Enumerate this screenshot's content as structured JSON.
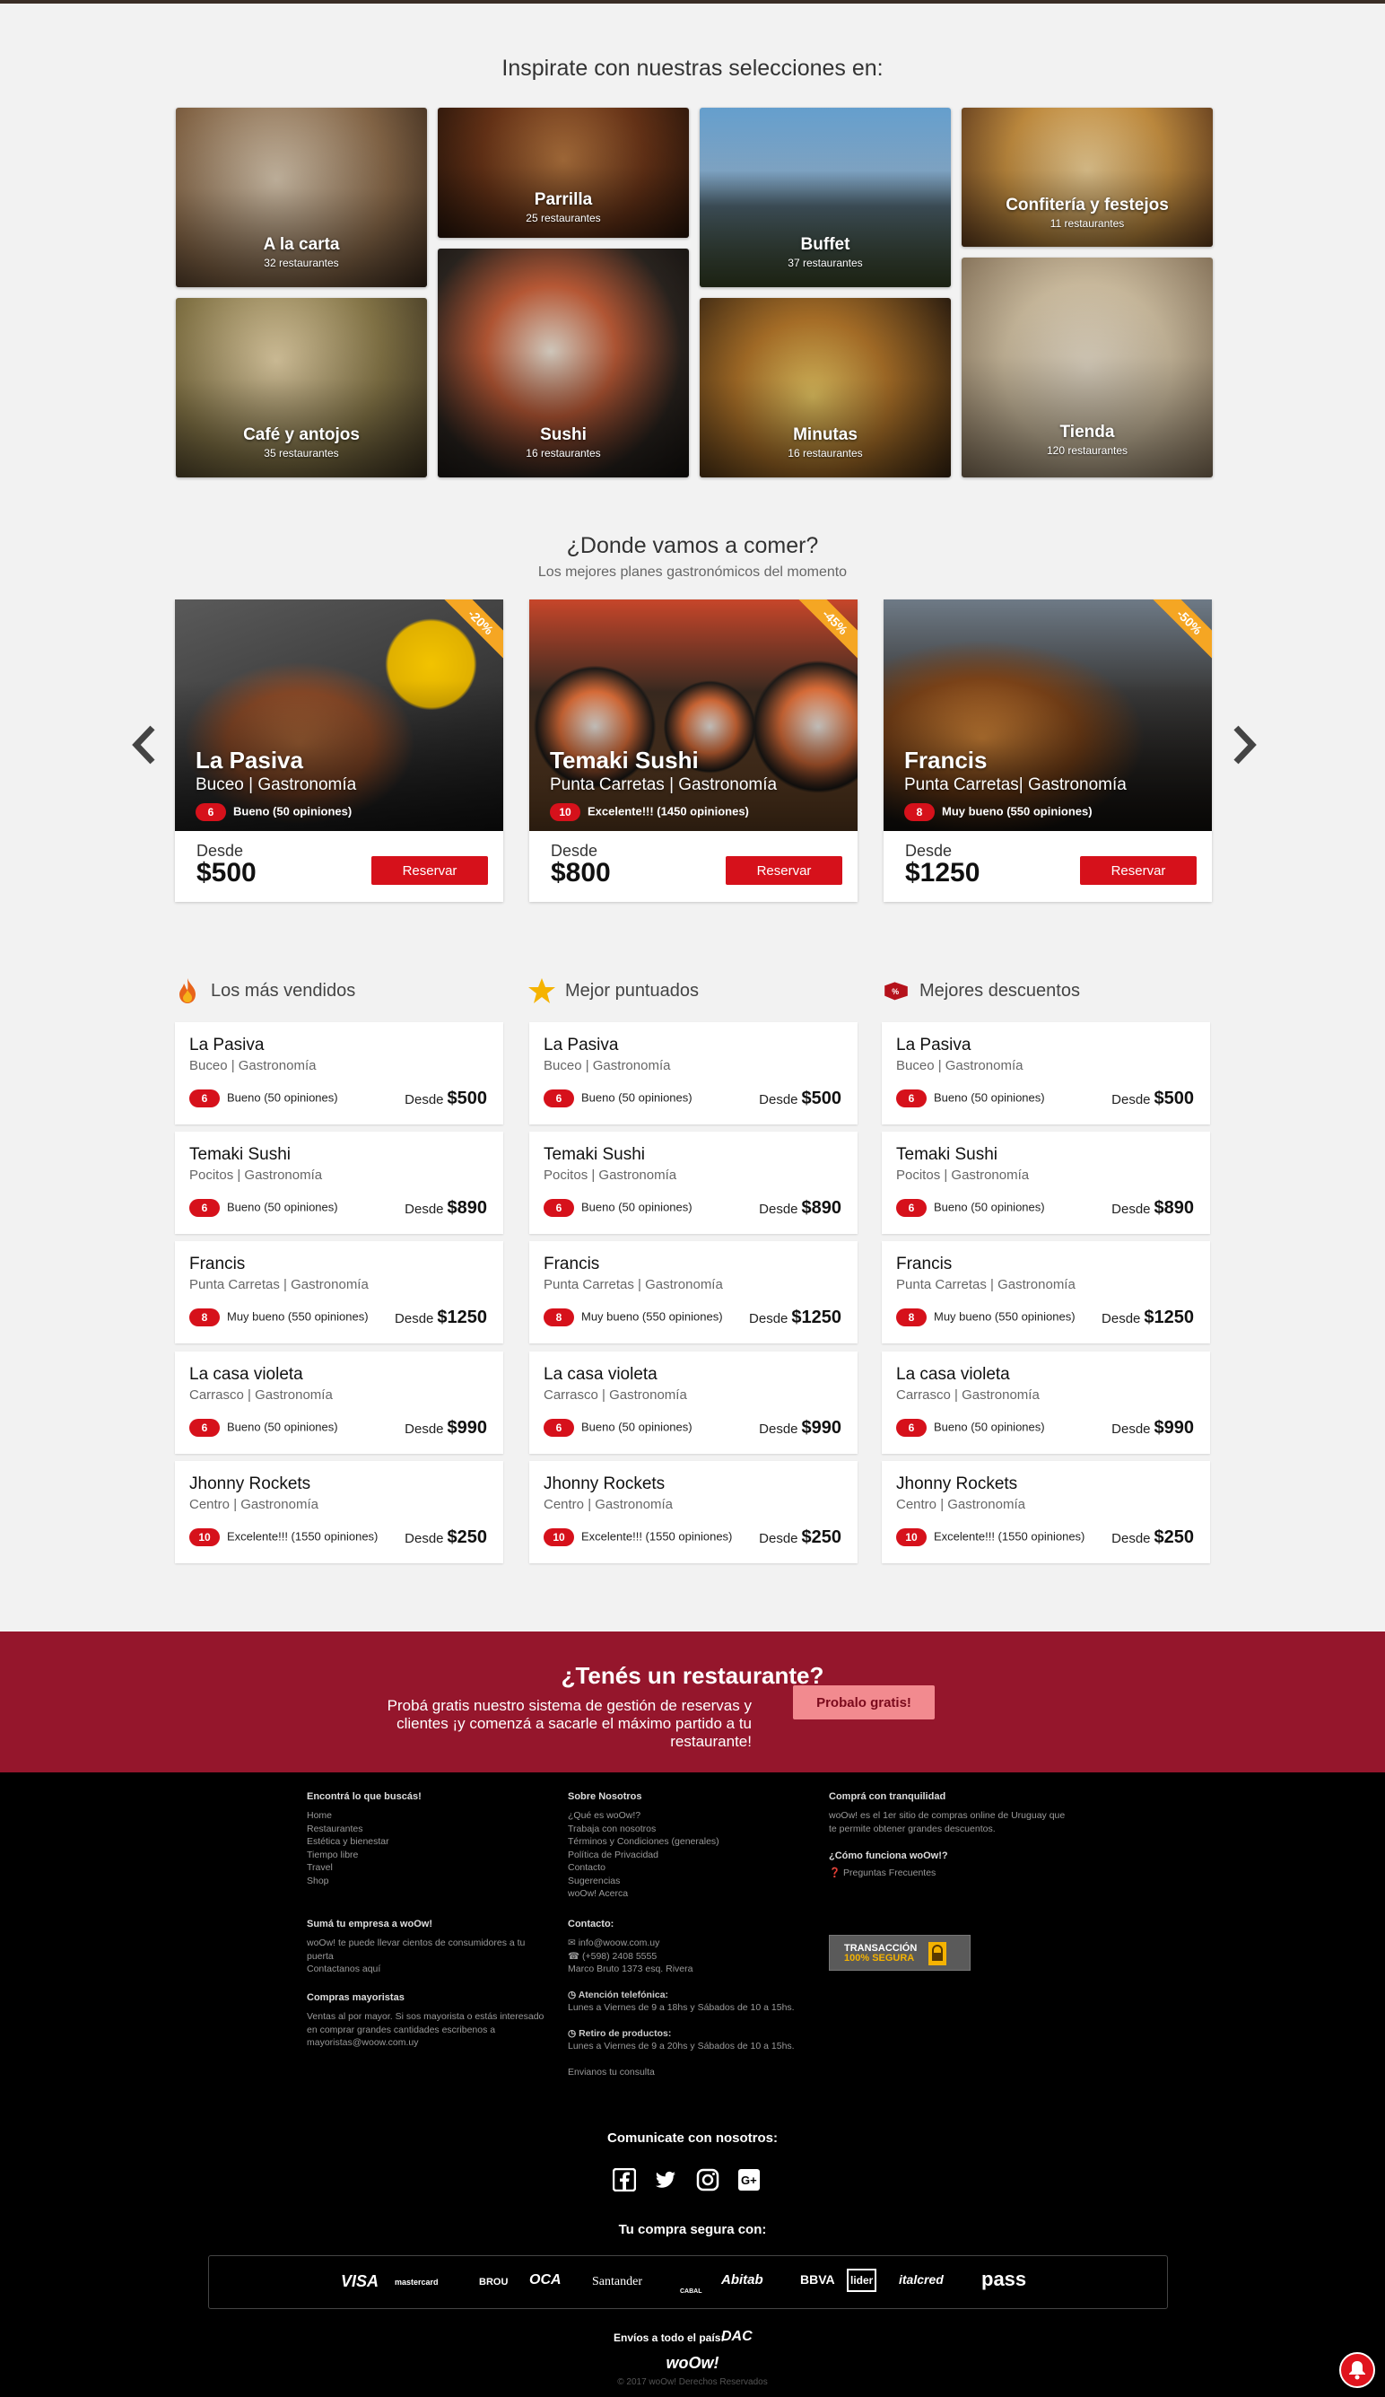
{
  "inspire": {
    "title": "Inspirate con nuestras selecciones en:",
    "tiles": [
      {
        "name": "A la carta",
        "count": "32 restaurantes"
      },
      {
        "name": "Parrilla",
        "count": "25 restaurantes"
      },
      {
        "name": "Buffet",
        "count": "37 restaurantes"
      },
      {
        "name": "Confitería y festejos",
        "count": "11 restaurantes"
      },
      {
        "name": "Café y antojos",
        "count": "35 restaurantes"
      },
      {
        "name": "Sushi",
        "count": "16 restaurantes"
      },
      {
        "name": "Minutas",
        "count": "16 restaurantes"
      },
      {
        "name": "Tienda",
        "count": "120 restaurantes"
      }
    ]
  },
  "deals": {
    "title": "¿Donde vamos a comer?",
    "subtitle": "Los mejores planes gastronómicos del momento",
    "items": [
      {
        "name": "La Pasiva",
        "location": "Buceo | Gastronomía",
        "score": "6",
        "rating": "Bueno (50 opiniones)",
        "discount": "-20%",
        "desde": "Desde",
        "price": "$500",
        "button": "Reservar"
      },
      {
        "name": "Temaki Sushi",
        "location": "Punta Carretas | Gastronomía",
        "score": "10",
        "rating": "Excelente!!! (1450 opiniones)",
        "discount": "-45%",
        "desde": "Desde",
        "price": "$800",
        "button": "Reservar"
      },
      {
        "name": "Francis",
        "location": "Punta Carretas| Gastronomía",
        "score": "8",
        "rating": "Muy bueno (550 opiniones)",
        "discount": "-50%",
        "desde": "Desde",
        "price": "$1250",
        "button": "Reservar"
      }
    ]
  },
  "lists": {
    "columns": [
      {
        "title": "Los más vendidos",
        "icon": "flame-icon"
      },
      {
        "title": "Mejor puntuados",
        "icon": "star-icon"
      },
      {
        "title": "Mejores descuentos",
        "icon": "discount-tag-icon"
      }
    ],
    "items": [
      {
        "name": "La Pasiva",
        "location": "Buceo | Gastronomía",
        "score": "6",
        "rating": "Bueno (50 opiniones)",
        "desde": "Desde",
        "price": "$500"
      },
      {
        "name": "Temaki Sushi",
        "location": "Pocitos | Gastronomía",
        "score": "6",
        "rating": "Bueno (50 opiniones)",
        "desde": "Desde",
        "price": "$890"
      },
      {
        "name": "Francis",
        "location": "Punta Carretas | Gastronomía",
        "score": "8",
        "rating": "Muy bueno (550 opiniones)",
        "desde": "Desde",
        "price": "$1250"
      },
      {
        "name": "La casa violeta",
        "location": "Carrasco | Gastronomía",
        "score": "6",
        "rating": "Bueno (50 opiniones)",
        "desde": "Desde",
        "price": "$990"
      },
      {
        "name": "Jhonny Rockets",
        "location": "Centro | Gastronomía",
        "score": "10",
        "rating": "Excelente!!! (1550 opiniones)",
        "desde": "Desde",
        "price": "$250"
      }
    ]
  },
  "owner": {
    "title": "¿Tenés un restaurante?",
    "text": "Probá gratis nuestro sistema de gestión de reservas y clientes ¡y comenzá a sacarle el máximo partido a tu restaurante!",
    "button": "Probalo gratis!"
  },
  "footer": {
    "col1": {
      "heading": "Encontrá lo que buscás!",
      "links": [
        "Home",
        "Restaurantes",
        "Estética y bienestar",
        "Tiempo libre",
        "Travel",
        "Shop"
      ]
    },
    "col1b": {
      "heading": "Sumá tu empresa a woOw!",
      "lines": [
        "woOw! te puede llevar cientos de consumidores a tu",
        "puerta",
        "Contactanos aquí"
      ]
    },
    "col1c": {
      "heading": "Compras mayoristas",
      "lines": [
        "Ventas al por mayor. Si sos mayorista o estás interesado",
        "en comprar grandes cantidades escribenos a",
        "mayoristas@woow.com.uy"
      ]
    },
    "col2": {
      "heading": "Sobre Nosotros",
      "links": [
        "¿Qué es woOw!?",
        "Trabaja con nosotros",
        "Términos y Condiciones (generales)",
        "Política de Privacidad",
        "Contacto",
        "Sugerencias",
        "woOw! Acerca"
      ]
    },
    "contact": {
      "heading": "Contacto:",
      "email": "info@woow.com.uy",
      "phone": "(+598) 2408 5555",
      "address": "Marco Bruto 1373 esq. Rivera",
      "phone_hours_title": "Atención telefónica:",
      "phone_hours": "Lunes a Viernes de 9 a 18hs y Sábados de 10 a 15hs.",
      "pickup_title": "Retiro de productos:",
      "pickup_hours": "Lunes a Viernes de 9 a 20hs y Sábados de 10 a 15hs.",
      "send": "Envianos tu consulta"
    },
    "col3": {
      "heading": "Comprá con tranquilidad",
      "lines": [
        "woOw! es el 1er sitio de compras online de Uruguay que",
        "te permite obtener grandes descuentos."
      ],
      "how_heading": "¿Cómo funciona woOw!?",
      "faq": "Preguntas Frecuentes",
      "secure_line1": "TRANSACCIÓN",
      "secure_line2": "100% SEGURA"
    },
    "social_title": "Comunicate con nosotros:",
    "social_icons": [
      "facebook-icon",
      "twitter-icon",
      "instagram-icon",
      "google-plus-icon"
    ],
    "secure_title": "Tu compra segura con:",
    "payments": [
      "VISA",
      "mastercard",
      "BROU",
      "OCA",
      "Santander",
      "CABAL",
      "Abitab",
      "BBVA",
      "lider",
      "italcred",
      "pass"
    ],
    "shipping": "Envíos a todo el país:",
    "shipping_brand": "DAC",
    "logo": "woOw!",
    "copyright": "© 2017 woOw! Derechos Reservados"
  },
  "colors": {
    "brand_red": "#d6111b",
    "banner": "#95162c",
    "ribbon": "#f5a623"
  }
}
